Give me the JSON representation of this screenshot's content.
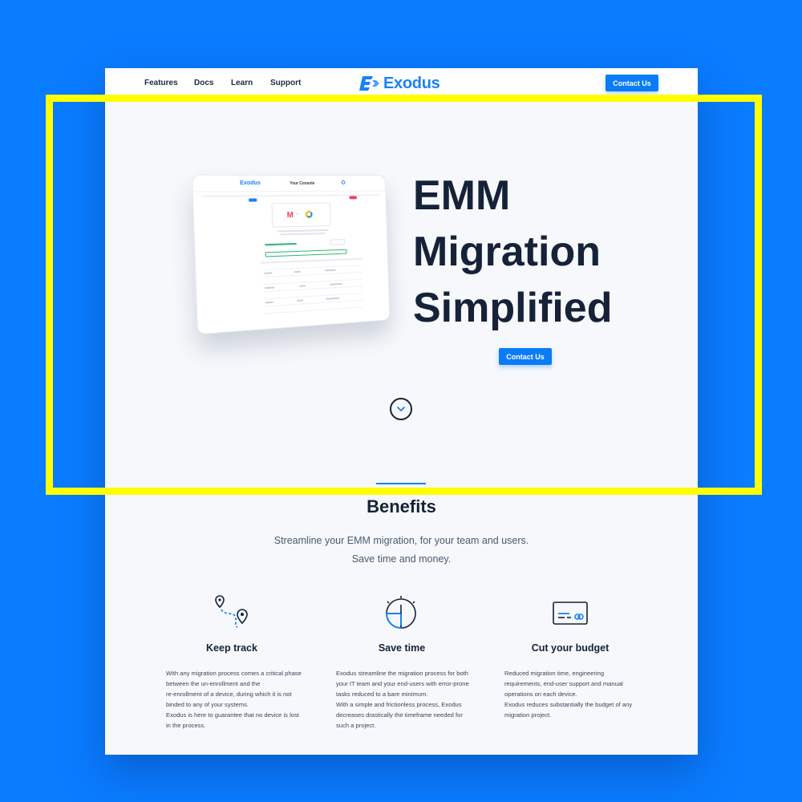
{
  "nav": {
    "links": [
      "Features",
      "Docs",
      "Learn",
      "Support"
    ],
    "logo_text": "Exodus",
    "cta_label": "Contact Us"
  },
  "hero": {
    "title_lines": [
      "EMM",
      "Migration",
      "Simplified"
    ],
    "cta_label": "Contact Us",
    "mockup": {
      "logo": "Exodus",
      "title": "Your Console"
    }
  },
  "benefits": {
    "title": "Benefits",
    "subtitle_lines": [
      "Streamline your EMM migration, for your team and users.",
      "Save time and money."
    ],
    "features": [
      {
        "icon": "map-pin-route-icon",
        "title": "Keep track",
        "text_lines": [
          "With any migration process comes a critical phase",
          "between the un-enrollment and the",
          "re-enrollment of a device, during which it is not",
          "binded to any of your systems.",
          "Exodus is here to guarantee that no device is lost",
          "in the process."
        ]
      },
      {
        "icon": "stopwatch-icon",
        "title": "Save time",
        "text_lines": [
          "Exodus streamline the migration process for both",
          "your IT team and your end-users with error-prone",
          "tasks reduced to a bare minimum.",
          "With a simple and frictionless process, Exodus",
          "decreases drastically the timeframe needed for",
          "such a project."
        ]
      },
      {
        "icon": "credit-card-icon",
        "title": "Cut your budget",
        "text_lines": [
          "Reduced migration time, engineering",
          "requirements, end-user support and manual",
          "operations on each device.",
          "Exodus reduces substantially the budget of any",
          "migration project."
        ]
      }
    ]
  },
  "colors": {
    "background": "#0a7cff",
    "accent": "#0b7cf5",
    "highlight_frame": "#ffff00",
    "heading": "#152238"
  }
}
